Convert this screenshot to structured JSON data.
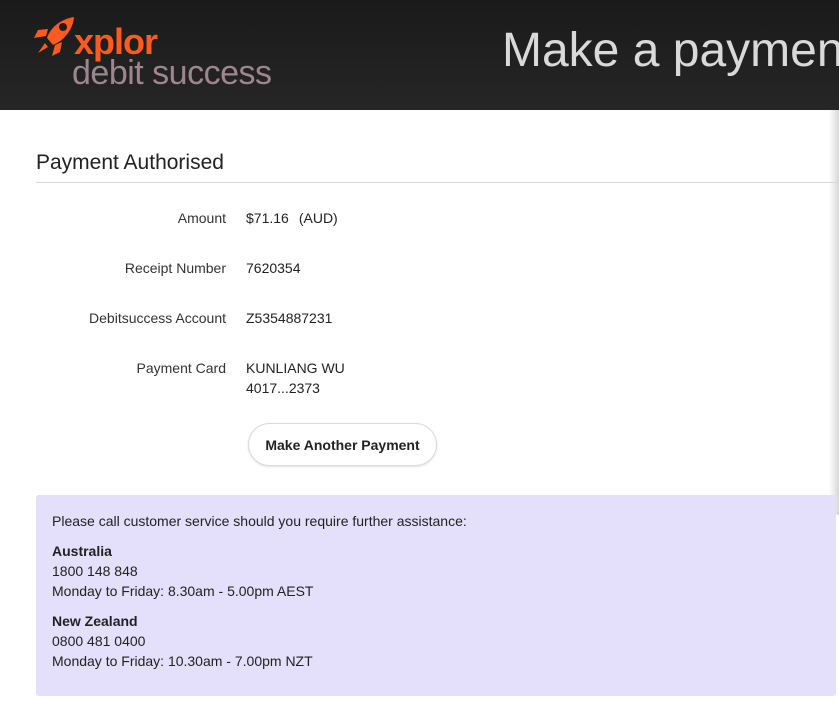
{
  "header": {
    "brand_top": "xplor",
    "brand_bottom": "debit success",
    "title": "Make a payment",
    "brand_color": "#ff5a1f"
  },
  "main": {
    "heading": "Payment Authorised",
    "amount": {
      "label": "Amount",
      "value": "$71.16",
      "currency": "(AUD)"
    },
    "receipt": {
      "label": "Receipt Number",
      "value": "7620354"
    },
    "account": {
      "label": "Debitsuccess Account",
      "value": "Z5354887231"
    },
    "card": {
      "label": "Payment Card",
      "name": "KUNLIANG WU",
      "number": "4017...2373"
    },
    "action_label": "Make Another Payment"
  },
  "support": {
    "intro": "Please call customer service should you require further assistance:",
    "background": "#e4dffb",
    "regions": [
      {
        "name": "Australia",
        "phone": "1800 148 848",
        "hours": "Monday to Friday: 8.30am - 5.00pm AEST"
      },
      {
        "name": "New Zealand",
        "phone": "0800 481 0400",
        "hours": "Monday to Friday: 10.30am - 7.00pm NZT"
      }
    ]
  }
}
